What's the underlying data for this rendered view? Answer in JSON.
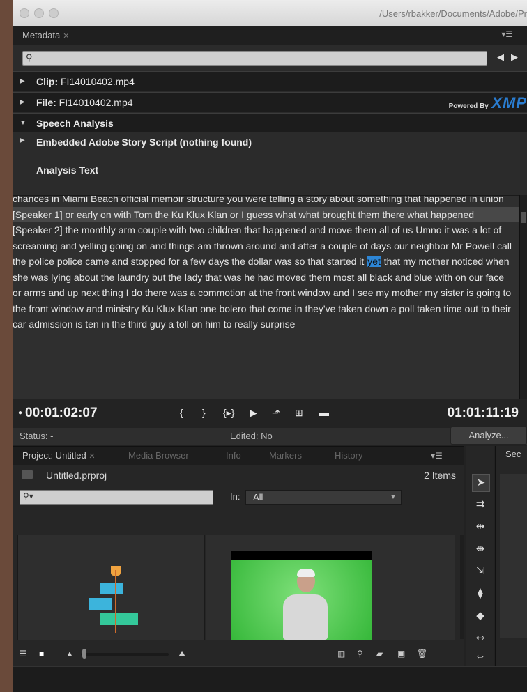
{
  "window": {
    "title_path": "/Users/rbakker/Documents/Adobe/Pr"
  },
  "metadata_panel": {
    "tab_label": "Metadata",
    "search_placeholder": "",
    "clip_label": "Clip:",
    "clip_value": "FI14010402.mp4",
    "file_label": "File:",
    "file_value": "FI14010402.mp4",
    "powered_by": "Powered By",
    "xmp_logo": "XMP",
    "speech_analysis": "Speech Analysis",
    "embedded_script": "Embedded Adobe Story Script (nothing found)",
    "analysis_text_heading": "Analysis Text",
    "paragraphs": [
      "chances in Miami Beach official memoir structure you were telling a story about something that happened in union",
      "[Speaker 1] or early on with Tom the Ku Klux Klan or I guess what what brought them there what happened"
    ],
    "para3_before": "[Speaker 2] the monthly arm couple with two children that happened and move them all of us Umno it was a lot of screaming and yelling going on and things am thrown around and after a couple of days our neighbor Mr Powell call the police police came and stopped for a few days the dollar was so that started it ",
    "para3_highlight": "yet",
    "para3_after": " that my mother noticed when she was lying about the laundry but the lady that was he had moved them most all black and blue with on our face or arms and up next thing I do there was a commotion at the front window and I see my mother my sister is going to the front window and ministry Ku Klux Klan one bolero that come in they've taken down a poll taken time out to their car admission is ten in the third guy a toll on him to really surprise",
    "timecode_in": "00:01:02:07",
    "timecode_out": "01:01:11:19",
    "status": "Status: -",
    "edited": "Edited: No",
    "analyze_button": "Analyze..."
  },
  "project_panel": {
    "tabs": [
      "Project: Untitled",
      "Media Browser",
      "Info",
      "Markers",
      "History"
    ],
    "project_file": "Untitled.prproj",
    "item_count": "2 Items",
    "in_label": "In:",
    "in_value": "All"
  },
  "sequence_panel": {
    "tab_label": "Sec"
  },
  "colors": {
    "highlight": "#2d86d6",
    "xmp_blue": "#2a7dd1",
    "seq_blue": "#3cb4dc",
    "seq_green": "#34c89a",
    "playhead": "#cf6b2b"
  }
}
